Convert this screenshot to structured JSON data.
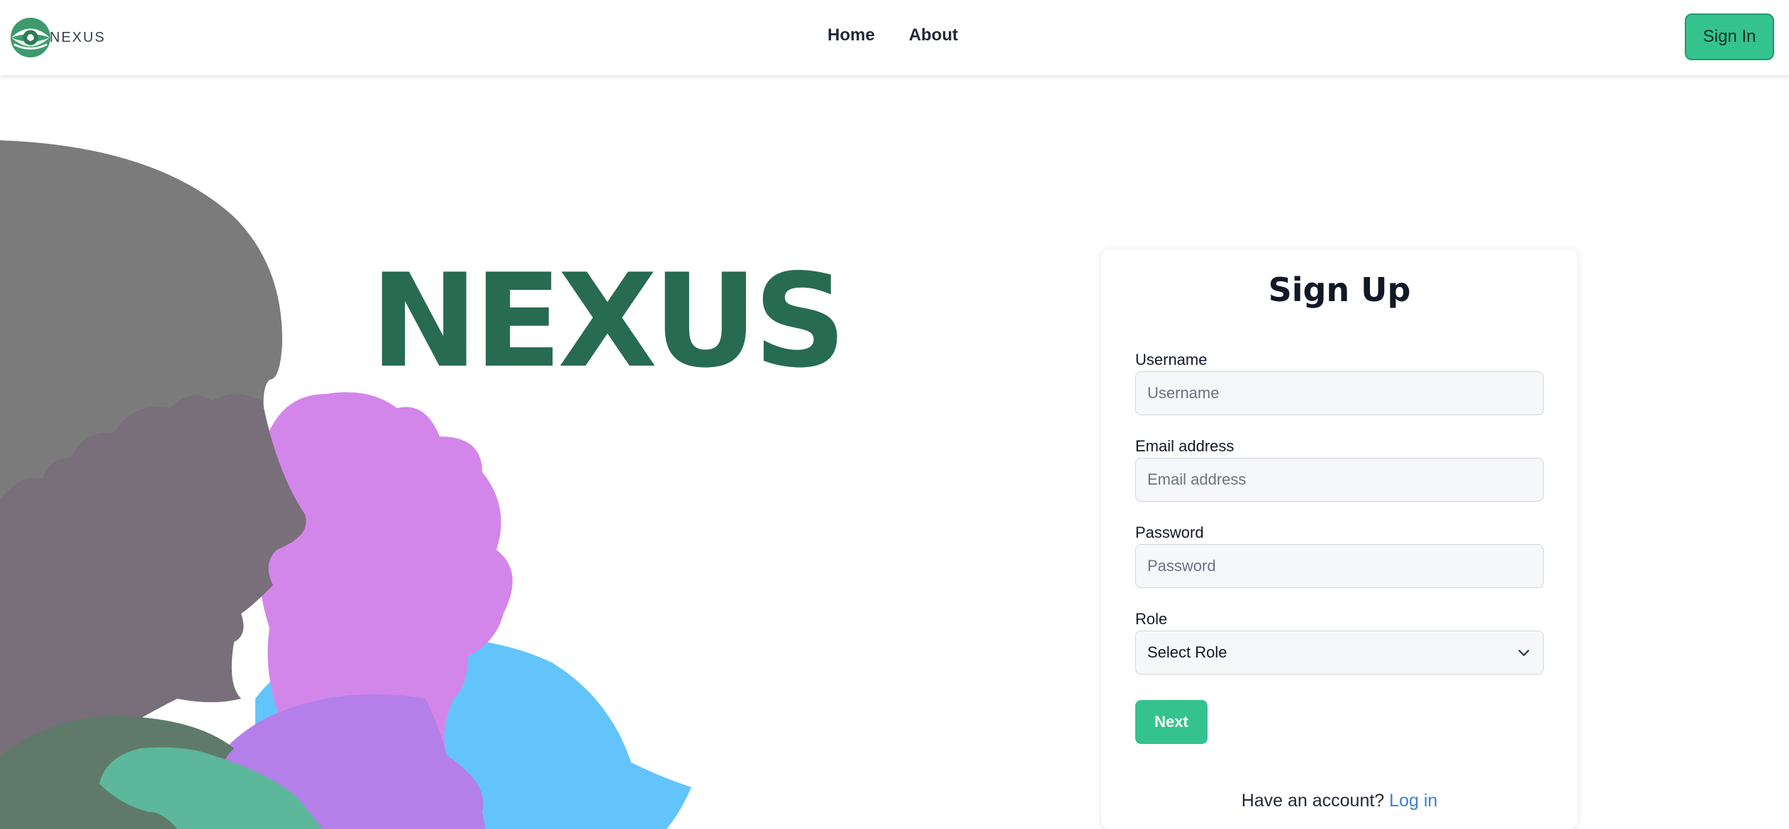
{
  "header": {
    "logo_text": "NEXUS",
    "nav": [
      {
        "label": "Home"
      },
      {
        "label": "About"
      }
    ],
    "signin_label": "Sign In"
  },
  "hero": {
    "title": "NEXUS"
  },
  "signup": {
    "title": "Sign Up",
    "username": {
      "label": "Username",
      "placeholder": "Username",
      "value": ""
    },
    "email": {
      "label": "Email address",
      "placeholder": "Email address",
      "value": ""
    },
    "password": {
      "label": "Password",
      "placeholder": "Password",
      "value": ""
    },
    "role": {
      "label": "Role",
      "selected": "Select Role"
    },
    "next_label": "Next",
    "account_prompt": "Have an account?",
    "login_label": "Log in"
  },
  "colors": {
    "brand_green": "#276b52",
    "accent_green": "#34c38f",
    "link_blue": "#3b7fd4"
  },
  "icons": {
    "logo": "eye-logo-icon",
    "select": "chevron-down-icon"
  }
}
